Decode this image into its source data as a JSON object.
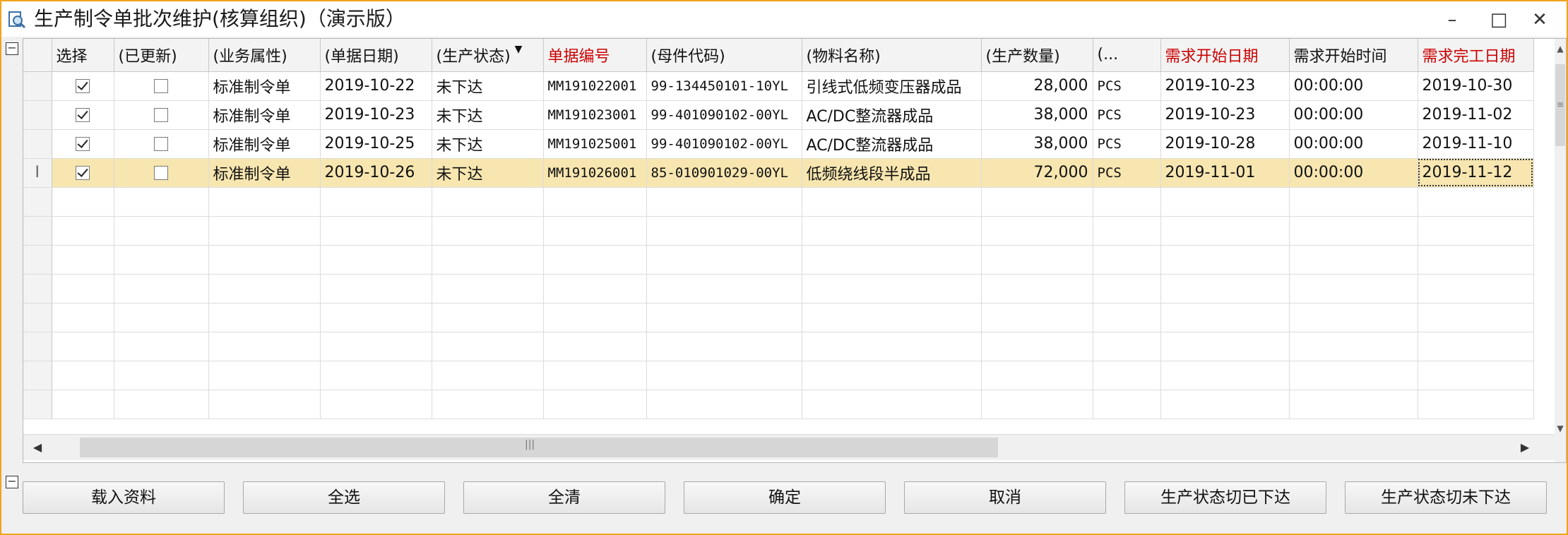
{
  "window": {
    "title": "生产制令单批次维护(核算组织)（演示版）",
    "minimize": "–",
    "maximize": "□",
    "close": "✕"
  },
  "grid": {
    "columns": [
      "选择",
      "(已更新)",
      "(业务属性)",
      "(单据日期)",
      "(生产状态)",
      "单据编号",
      "(母件代码)",
      "(物料名称)",
      "(生产数量)",
      "(...",
      "需求开始日期",
      "需求开始时间",
      "需求完工日期"
    ],
    "required_columns": [
      "单据编号",
      "需求开始日期",
      "需求完工日期"
    ],
    "rows": [
      {
        "selected": true,
        "updated": false,
        "biz": "标准制令单",
        "date": "2019-10-22",
        "status": "未下达",
        "doc_no": "MM191022001",
        "parent_code": "99-134450101-10YL",
        "material": "引线式低频变压器成品",
        "qty": "28,000",
        "unit": "PCS",
        "start_date": "2019-10-23",
        "start_time": "00:00:00",
        "finish_date": "2019-10-30"
      },
      {
        "selected": true,
        "updated": false,
        "biz": "标准制令单",
        "date": "2019-10-23",
        "status": "未下达",
        "doc_no": "MM191023001",
        "parent_code": "99-401090102-00YL",
        "material": "AC/DC整流器成品",
        "qty": "38,000",
        "unit": "PCS",
        "start_date": "2019-10-23",
        "start_time": "00:00:00",
        "finish_date": "2019-11-02"
      },
      {
        "selected": true,
        "updated": false,
        "biz": "标准制令单",
        "date": "2019-10-25",
        "status": "未下达",
        "doc_no": "MM191025001",
        "parent_code": "99-401090102-00YL",
        "material": "AC/DC整流器成品",
        "qty": "38,000",
        "unit": "PCS",
        "start_date": "2019-10-28",
        "start_time": "00:00:00",
        "finish_date": "2019-11-10"
      },
      {
        "selected": true,
        "updated": false,
        "biz": "标准制令单",
        "date": "2019-10-26",
        "status": "未下达",
        "doc_no": "MM191026001",
        "parent_code": "85-010901029-00YL",
        "material": "低频绕线段半成品",
        "qty": "72,000",
        "unit": "PCS",
        "start_date": "2019-11-01",
        "start_time": "00:00:00",
        "finish_date": "2019-11-12"
      }
    ],
    "current_row_marker": "I"
  },
  "buttons": {
    "load": "载入资料",
    "select_all": "全选",
    "clear_all": "全清",
    "confirm": "确定",
    "cancel": "取消",
    "to_released": "生产状态切已下达",
    "to_unreleased": "生产状态切未下达"
  },
  "colors": {
    "window_border": "#f3a21d",
    "selected_row": "#f7e6b0",
    "required_header": "#cc0000"
  }
}
